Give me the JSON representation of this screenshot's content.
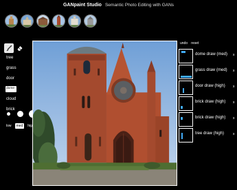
{
  "header": {
    "title": "GANpaint Studio",
    "subtitle": "Semantic Photo Editing with GANs"
  },
  "thumbnails": [
    {
      "icon": "church-thumbnail-1"
    },
    {
      "icon": "church-thumbnail-2"
    },
    {
      "icon": "church-thumbnail-3"
    },
    {
      "icon": "church-thumbnail-4"
    },
    {
      "icon": "church-thumbnail-5"
    },
    {
      "icon": "church-thumbnail-6"
    }
  ],
  "tools": {
    "brush_icon": "brush-icon",
    "eraser_icon": "eraser-icon",
    "active": "brush"
  },
  "features": [
    "tree",
    "grass",
    "door",
    "dome",
    "cloud",
    "brick"
  ],
  "selected_feature": "dome",
  "brush": {
    "labels": [
      "low",
      "med",
      "high"
    ],
    "selected": "med"
  },
  "history": {
    "undo_label": "undo",
    "reset_label": "reset",
    "items": [
      {
        "label": "dome draw (med)",
        "close": "x"
      },
      {
        "label": "grass draw (med)",
        "close": "x"
      },
      {
        "label": "door draw (high)",
        "close": "x"
      },
      {
        "label": "brick draw (high)",
        "close": "x"
      },
      {
        "label": "brick draw (high)",
        "close": "x"
      },
      {
        "label": "tree draw (high)",
        "close": "x"
      }
    ]
  },
  "colors": {
    "background": "#000000",
    "accent": "#3fa9f5",
    "brick": "#a8492c",
    "sky": "#8fb3dc"
  }
}
